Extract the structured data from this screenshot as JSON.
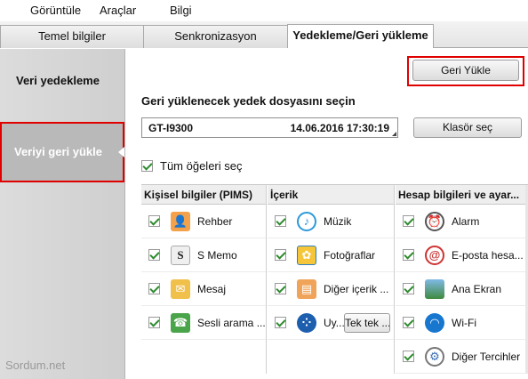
{
  "menu": [
    "Görüntüle",
    "Araçlar",
    "Bilgi"
  ],
  "tabs": [
    "Temel bilgiler",
    "Senkronizasyon",
    "Yedekleme/Geri yükleme"
  ],
  "sidebar": {
    "items": [
      {
        "label": "Veri yedekleme"
      },
      {
        "label": "Veriyi geri yükle"
      }
    ]
  },
  "watermark": "Sordum.net",
  "restore_button": "Geri Yükle",
  "select_title": "Geri yüklenecek yedek dosyasını seçin",
  "backup": {
    "device": "GT-I9300",
    "date": "14.06.2016 17:30:19"
  },
  "folder_button": "Klasör seç",
  "select_all": "Tüm öğeleri seç",
  "columns": [
    {
      "header": "Kişisel bilgiler (PIMS)",
      "items": [
        {
          "label": "Rehber",
          "icon": "contacts-icon"
        },
        {
          "label": "S Memo",
          "icon": "s-memo-icon"
        },
        {
          "label": "Mesaj",
          "icon": "message-icon"
        },
        {
          "label": "Sesli arama ...",
          "icon": "call-icon"
        }
      ]
    },
    {
      "header": "İçerik",
      "items": [
        {
          "label": "Müzik",
          "icon": "music-icon"
        },
        {
          "label": "Fotoğraflar",
          "icon": "photos-icon"
        },
        {
          "label": "Diğer içerik ...",
          "icon": "other-content-icon"
        },
        {
          "label": "Uy...",
          "icon": "apps-icon",
          "button": "Tek tek ..."
        }
      ]
    },
    {
      "header": "Hesap bilgileri ve ayar...",
      "items": [
        {
          "label": "Alarm",
          "icon": "alarm-icon"
        },
        {
          "label": "E-posta hesa...",
          "icon": "email-icon"
        },
        {
          "label": "Ana Ekran",
          "icon": "home-screen-icon"
        },
        {
          "label": "Wi-Fi",
          "icon": "wifi-icon"
        },
        {
          "label": "Diğer Tercihler",
          "icon": "preferences-icon"
        }
      ]
    }
  ],
  "colors": {
    "highlight": "#e00000",
    "check": "#2e8b2e",
    "sidebar_active": "#b9b9b9"
  }
}
